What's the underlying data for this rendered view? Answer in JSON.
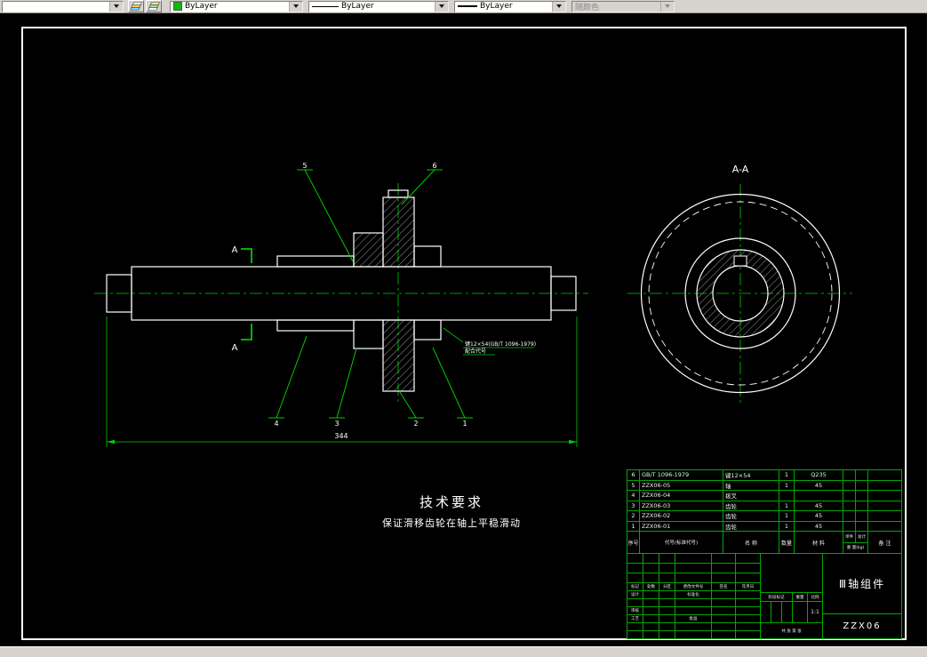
{
  "toolbar": {
    "layer_combo": {
      "value": ""
    },
    "color_combo": {
      "value": "ByLayer"
    },
    "linetype_combo": {
      "value": "ByLayer"
    },
    "lineweight_combo": {
      "value": "ByLayer"
    },
    "plotstyle_combo": {
      "value": "随颜色"
    }
  },
  "drawing": {
    "section_label": "A-A",
    "section_mark": "A",
    "dimension_344": "344",
    "callouts": {
      "c1": "1",
      "c2": "2",
      "c3": "3",
      "c4": "4",
      "c5": "5",
      "c6": "6"
    },
    "note_line1": "键12×54(GB/T 1096-1979)",
    "note_line2": "配合代号",
    "tech_req_title": "技术要求",
    "tech_req_body": "保证滑移齿轮在轴上平稳滑动"
  },
  "parts_list": {
    "header": {
      "no": "序号",
      "code": "代号(标准代号)",
      "name": "名 称",
      "qty": "数量",
      "material": "材 料",
      "weight_each": "单件",
      "weight_total": "总计",
      "weight_unit": "重 量(kg)",
      "notes": "备 注"
    },
    "rows": [
      {
        "no": "6",
        "code": "GB/T 1096-1979",
        "name": "键12×54",
        "qty": "1",
        "material": "Q235",
        "weight_each": "",
        "weight_total": "",
        "notes": ""
      },
      {
        "no": "5",
        "code": "ZZX06-05",
        "name": "轴",
        "qty": "1",
        "material": "45",
        "weight_each": "",
        "weight_total": "",
        "notes": ""
      },
      {
        "no": "4",
        "code": "ZZX06-04",
        "name": "拨叉",
        "qty": "",
        "material": "",
        "weight_each": "",
        "weight_total": "",
        "notes": ""
      },
      {
        "no": "3",
        "code": "ZZX06-03",
        "name": "齿轮",
        "qty": "1",
        "material": "45",
        "weight_each": "",
        "weight_total": "",
        "notes": ""
      },
      {
        "no": "2",
        "code": "ZZX06-02",
        "name": "齿轮",
        "qty": "1",
        "material": "45",
        "weight_each": "",
        "weight_total": "",
        "notes": ""
      },
      {
        "no": "1",
        "code": "ZZX06-01",
        "name": "齿轮",
        "qty": "1",
        "material": "45",
        "weight_each": "",
        "weight_total": "",
        "notes": ""
      }
    ]
  },
  "title_block": {
    "revision_headers": [
      "标记",
      "处数",
      "分区",
      "更改文件号",
      "签名",
      "年月日"
    ],
    "design_label": "设计",
    "standard_label": "标准化",
    "audit_label": "审核",
    "process_label": "工艺",
    "approve_label": "批准",
    "stage_label": "阶段标记",
    "weight_label": "重量",
    "scale_label": "比例",
    "scale_value": "1:1",
    "sheets_label": "共 张 第 张",
    "title": "Ⅲ轴组件",
    "drawing_no": "ZZX06"
  }
}
